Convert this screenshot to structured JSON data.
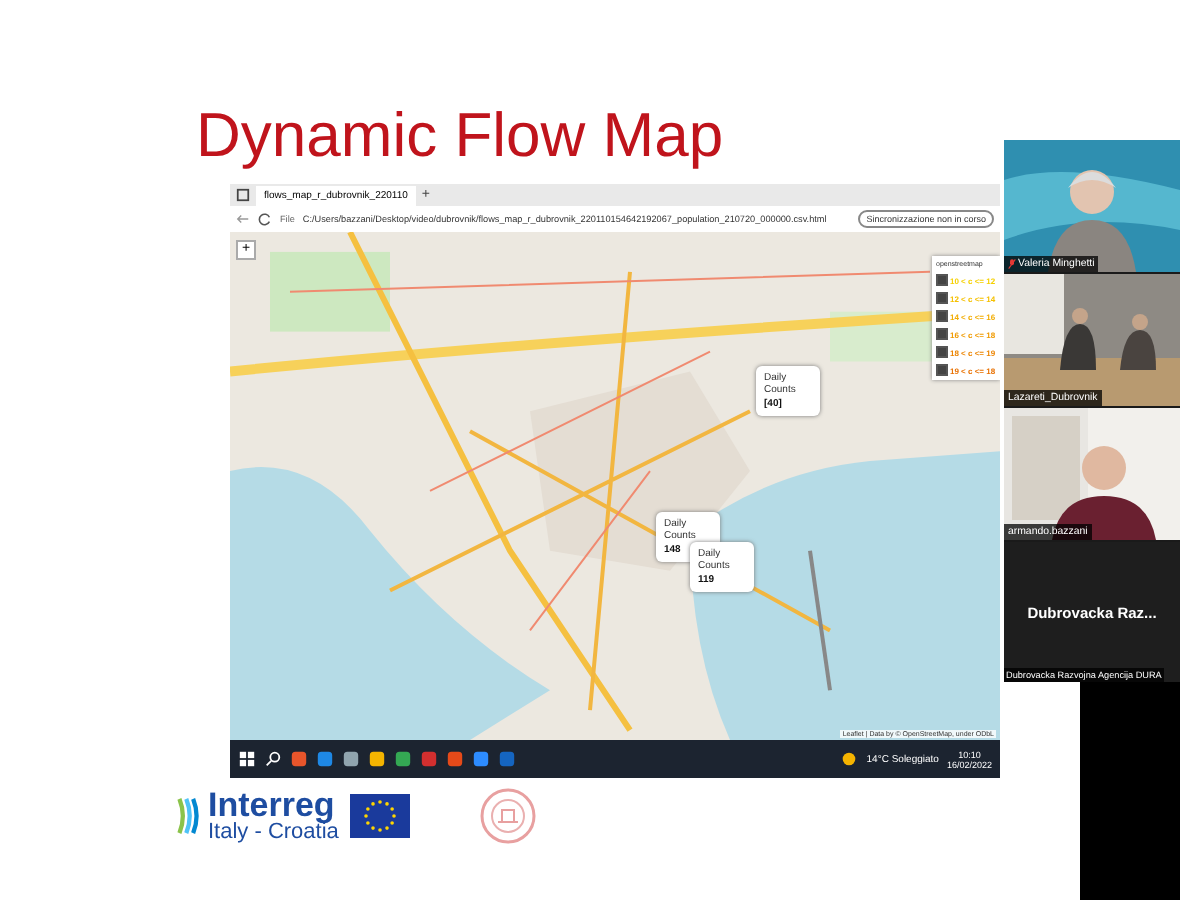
{
  "slide": {
    "title": "Dynamic Flow Map"
  },
  "browser": {
    "tab_title": "flows_map_r_dubrovnik_220110",
    "new_tab": "+",
    "url_prefix": "File",
    "url": "C:/Users/bazzani/Desktop/video/dubrovnik/flows_map_r_dubrovnik_220110154642192067_population_210720_000000.csv.html",
    "sync_button": "Sincronizzazione non in corso",
    "map": {
      "zoom_in": "+",
      "base_layer": "openstreetmap",
      "legend": [
        {
          "label": "10 < c <= 12",
          "color": "#f5d000",
          "checked": true
        },
        {
          "label": "12 < c <= 14",
          "color": "#f5c000",
          "checked": true
        },
        {
          "label": "14 < c <= 16",
          "color": "#f2ac00",
          "checked": true
        },
        {
          "label": "16 < c <= 18",
          "color": "#f09a00",
          "checked": true
        },
        {
          "label": "18 < c <= 19",
          "color": "#ec8400",
          "checked": true
        },
        {
          "label": "19 < c <= 18",
          "color": "#e87000",
          "checked": true
        }
      ],
      "popups": [
        {
          "label": "Daily Counts",
          "value": "[40]"
        },
        {
          "label": "Daily Counts",
          "value": "148"
        },
        {
          "label": "Daily Counts",
          "value": "119"
        }
      ],
      "attribution": "Leaflet | Data by © OpenStreetMap, under ODbL"
    }
  },
  "taskbar": {
    "weather": "14°C Soleggiato",
    "time": "10:10",
    "date": "16/02/2022"
  },
  "logos": {
    "program": "Interreg",
    "region": "Italy - Croatia"
  },
  "participants": [
    {
      "kind": "video",
      "name": "Valeria Minghetti",
      "muted": true
    },
    {
      "kind": "video",
      "name": "Lazareti_Dubrovnik",
      "muted": false
    },
    {
      "kind": "video",
      "name": "armando.bazzani",
      "muted": false
    },
    {
      "kind": "avatar",
      "display_name": "Dubrovacka  Raz...",
      "name": "Dubrovacka Razvojna Agencija DURA",
      "muted": false
    }
  ]
}
